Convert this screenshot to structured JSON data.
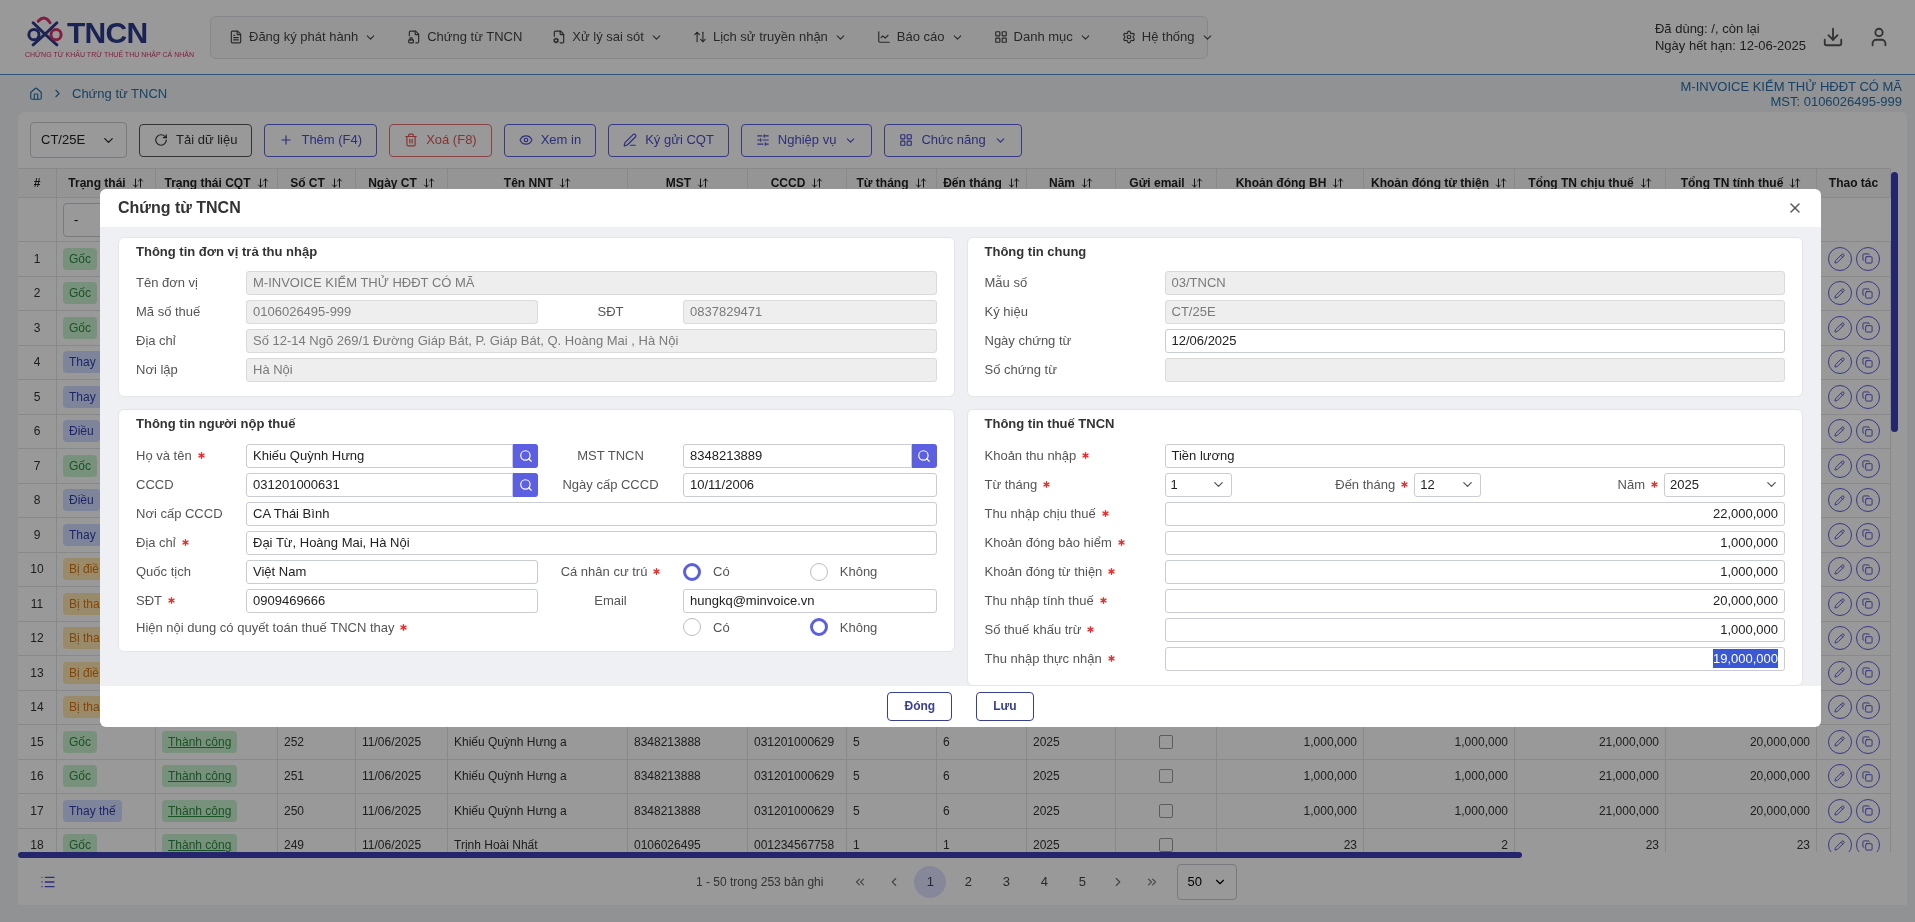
{
  "header": {
    "logo": "TNCN",
    "logo_tagline": "CHỨNG TỪ KHẤU TRỪ THUẾ THU NHẬP CÁ NHÂN",
    "nav": [
      {
        "label": "Đăng ký phát hành",
        "menu": true
      },
      {
        "label": "Chứng từ TNCN",
        "menu": false
      },
      {
        "label": "Xử lý sai sót",
        "menu": true
      },
      {
        "label": "Lịch sử truyền nhận",
        "menu": true
      },
      {
        "label": "Báo cáo",
        "menu": true
      },
      {
        "label": "Danh mục",
        "menu": true
      },
      {
        "label": "Hệ thống",
        "menu": true
      }
    ],
    "usage": "Đã dùng: /, còn lại",
    "expiry": "Ngày hết hạn: 12-06-2025"
  },
  "breadcrumb": [
    "Chứng từ TNCN"
  ],
  "company": {
    "name": "M-INVOICE KIỂM THỬ HĐĐT CÓ MÃ",
    "tax_code": "MST: 0106026495-999"
  },
  "toolbar": {
    "series": "CT/25E",
    "buttons": [
      {
        "label": "Tải dữ liệu",
        "kind": "plain",
        "menu": false
      },
      {
        "label": "Thêm (F4)",
        "kind": "primary",
        "menu": false
      },
      {
        "label": "Xoá (F8)",
        "kind": "danger",
        "menu": false
      },
      {
        "label": "Xem in",
        "kind": "primary",
        "menu": false
      },
      {
        "label": "Ký gửi CQT",
        "kind": "primary",
        "menu": false
      },
      {
        "label": "Nghiệp vụ",
        "kind": "primary",
        "menu": true
      },
      {
        "label": "Chức năng",
        "kind": "primary",
        "menu": true
      }
    ]
  },
  "table": {
    "columns": [
      {
        "label": "#",
        "sortable": false
      },
      {
        "label": "Trạng thái",
        "sortable": true
      },
      {
        "label": "Trạng thái CQT",
        "sortable": true
      },
      {
        "label": "Số CT",
        "sortable": true
      },
      {
        "label": "Ngày CT",
        "sortable": true
      },
      {
        "label": "Tên NNT",
        "sortable": true
      },
      {
        "label": "MST",
        "sortable": true
      },
      {
        "label": "CCCD",
        "sortable": true
      },
      {
        "label": "Từ tháng",
        "sortable": true
      },
      {
        "label": "Đến tháng",
        "sortable": true
      },
      {
        "label": "Năm",
        "sortable": true
      },
      {
        "label": "Gửi email",
        "sortable": true
      },
      {
        "label": "Khoản đóng BH",
        "sortable": true
      },
      {
        "label": "Khoản đóng từ thiện",
        "sortable": true
      },
      {
        "label": "Tổng TN chịu thuế",
        "sortable": true
      },
      {
        "label": "Tổng TN tính thuế",
        "sortable": true
      },
      {
        "label": "Thao tác",
        "sortable": false
      }
    ],
    "filter": "-",
    "rows": [
      {
        "number": "1",
        "status": {
          "label": "Gốc",
          "kind": "original"
        }
      },
      {
        "number": "2",
        "status": {
          "label": "Gốc",
          "kind": "original"
        }
      },
      {
        "number": "3",
        "status": {
          "label": "Gốc",
          "kind": "original"
        }
      },
      {
        "number": "4",
        "status": {
          "label": "Thay",
          "kind": "replacement"
        }
      },
      {
        "number": "5",
        "status": {
          "label": "Thay",
          "kind": "replacement"
        }
      },
      {
        "number": "6",
        "status": {
          "label": "Điều",
          "kind": "adjustment"
        }
      },
      {
        "number": "7",
        "status": {
          "label": "Gốc",
          "kind": "original"
        }
      },
      {
        "number": "8",
        "status": {
          "label": "Điều",
          "kind": "adjustment"
        }
      },
      {
        "number": "9",
        "status": {
          "label": "Thay",
          "kind": "replacement"
        }
      },
      {
        "number": "10",
        "status": {
          "label": "Bị điề",
          "kind": "adjusted"
        }
      },
      {
        "number": "11",
        "status": {
          "label": "Bị tha",
          "kind": "replaced"
        }
      },
      {
        "number": "12",
        "status": {
          "label": "Bị tha",
          "kind": "replaced"
        }
      },
      {
        "number": "13",
        "status": {
          "label": "Bị điề",
          "kind": "adjusted"
        }
      },
      {
        "number": "14",
        "status": {
          "label": "Bị tha",
          "kind": "replaced"
        }
      },
      {
        "number": "15",
        "status": {
          "label": "Gốc",
          "kind": "original"
        },
        "cqt_status": "Thành công",
        "so_ct": "252",
        "date": "11/06/2025",
        "name": "Khiếu Quỳnh Hưng a",
        "mst": "8348213888",
        "cccd": "031201000629",
        "from_month": "5",
        "to_month": "6",
        "year": "2025",
        "email_sent": false,
        "insurance": "1,000,000",
        "charity": "1,000,000",
        "taxable_total": "21,000,000",
        "assessable_total": "20,000,000"
      },
      {
        "number": "16",
        "status": {
          "label": "Gốc",
          "kind": "original"
        },
        "cqt_status": "Thành công",
        "so_ct": "251",
        "date": "11/06/2025",
        "name": "Khiếu Quỳnh Hưng a",
        "mst": "8348213888",
        "cccd": "031201000629",
        "from_month": "5",
        "to_month": "6",
        "year": "2025",
        "email_sent": false,
        "insurance": "1,000,000",
        "charity": "1,000,000",
        "taxable_total": "21,000,000",
        "assessable_total": "20,000,000"
      },
      {
        "number": "17",
        "status": {
          "label": "Thay thế",
          "kind": "replacement"
        },
        "cqt_status": "Thành công",
        "so_ct": "250",
        "date": "11/06/2025",
        "name": "Khiếu Quỳnh Hưng a",
        "mst": "8348213888",
        "cccd": "031201000629",
        "from_month": "5",
        "to_month": "6",
        "year": "2025",
        "email_sent": false,
        "insurance": "1,000,000",
        "charity": "1,000,000",
        "taxable_total": "21,000,000",
        "assessable_total": "20,000,000"
      },
      {
        "number": "18",
        "status": {
          "label": "Gốc",
          "kind": "original"
        },
        "cqt_status": "Thành công",
        "so_ct": "249",
        "date": "11/06/2025",
        "name": "Trịnh Hoài Nhất",
        "mst": "0106026495",
        "cccd": "001234567758",
        "from_month": "1",
        "to_month": "1",
        "year": "2025",
        "email_sent": false,
        "insurance": "23",
        "charity": "2",
        "taxable_total": "23",
        "assessable_total": "23"
      }
    ]
  },
  "pagination": {
    "summary": "1 - 50 trong 253 bản ghi",
    "pages": [
      {
        "label": "1",
        "selected": true
      },
      {
        "label": "2",
        "selected": false
      },
      {
        "label": "3",
        "selected": false
      },
      {
        "label": "4",
        "selected": false
      },
      {
        "label": "5",
        "selected": false
      }
    ],
    "page_size": "50"
  },
  "dialog": {
    "title": "Chứng từ TNCN",
    "left": [
      {
        "title": "Thông tin đơn vị trả thu nhập",
        "rows": [
          [
            {
              "kind": "text",
              "label": "Tên đơn vị",
              "value": "M-INVOICE KIỂM THỬ HĐĐT CÓ MÃ",
              "disabled": true,
              "required": false
            }
          ],
          [
            {
              "kind": "text",
              "label": "Mã số thuế",
              "value": "0106026495-999",
              "disabled": true,
              "required": false
            },
            {
              "kind": "text",
              "label": "SĐT",
              "value": "0837829471",
              "disabled": true,
              "required": false
            }
          ],
          [
            {
              "kind": "text",
              "label": "Địa chỉ",
              "value": "Số 12-14 Ngõ 269/1 Đường Giáp Bát, P. Giáp Bát, Q. Hoàng Mai , Hà Nội",
              "disabled": true,
              "required": false
            }
          ],
          [
            {
              "kind": "text",
              "label": "Nơi lập",
              "value": "Hà Nội",
              "disabled": true,
              "required": false
            }
          ]
        ]
      },
      {
        "title": "Thông tin người nộp thuế",
        "rows": [
          [
            {
              "kind": "text",
              "label": "Họ và tên",
              "value": "Khiếu Quỳnh Hưng",
              "disabled": false,
              "required": true,
              "search": true
            },
            {
              "kind": "text",
              "label": "MST TNCN",
              "value": "8348213889",
              "disabled": false,
              "required": false,
              "search": true
            }
          ],
          [
            {
              "kind": "text",
              "label": "CCCD",
              "value": "031201000631",
              "disabled": false,
              "required": false,
              "search": true
            },
            {
              "kind": "text",
              "label": "Ngày cấp CCCD",
              "value": "10/11/2006",
              "disabled": false,
              "required": false
            }
          ],
          [
            {
              "kind": "text",
              "label": "Nơi cấp CCCD",
              "value": "CA Thái Bình",
              "disabled": false,
              "required": false
            }
          ],
          [
            {
              "kind": "text",
              "label": "Địa chỉ",
              "value": "Đại Từ, Hoàng Mai, Hà Nội",
              "disabled": false,
              "required": true
            }
          ],
          [
            {
              "kind": "text",
              "label": "Quốc tịch",
              "value": "Việt Nam",
              "disabled": false,
              "required": false
            },
            {
              "kind": "radio",
              "label": "Cá nhân cư trú",
              "required": true,
              "options": [
                {
                  "label": "Có",
                  "selected": true
                },
                {
                  "label": "Không",
                  "selected": false
                }
              ]
            }
          ],
          [
            {
              "kind": "text",
              "label": "SĐT",
              "value": "0909469666",
              "disabled": false,
              "required": true
            },
            {
              "kind": "text",
              "label": "Email",
              "value": "hungkq@minvoice.vn",
              "disabled": false,
              "required": false
            }
          ],
          [
            {
              "kind": "radio",
              "label": "Hiện nội dung có quyết toán thuế TNCN thay",
              "required": true,
              "options": [
                {
                  "label": "Có",
                  "selected": false
                },
                {
                  "label": "Không",
                  "selected": true
                }
              ]
            }
          ]
        ]
      }
    ],
    "right": [
      {
        "title": "Thông tin chung",
        "rows": [
          [
            {
              "kind": "text",
              "label": "Mẫu số",
              "value": "03/TNCN",
              "disabled": true,
              "required": false
            }
          ],
          [
            {
              "kind": "text",
              "label": "Ký hiệu",
              "value": "CT/25E",
              "disabled": true,
              "required": false
            }
          ],
          [
            {
              "kind": "text",
              "label": "Ngày chứng từ",
              "value": "12/06/2025",
              "disabled": false,
              "required": false
            }
          ],
          [
            {
              "kind": "text",
              "label": "Số chứng từ",
              "disabled": true,
              "required": false
            }
          ]
        ]
      },
      {
        "title": "Thông tin thuế TNCN",
        "rows": [
          [
            {
              "kind": "text",
              "label": "Khoản thu nhập",
              "value": "Tiền lương",
              "disabled": false,
              "required": true
            }
          ],
          [
            {
              "kind": "select",
              "label": "Từ tháng",
              "value": "1",
              "required": true
            },
            {
              "kind": "select",
              "label": "Đến tháng",
              "value": "12",
              "required": true
            },
            {
              "kind": "select",
              "label": "Năm",
              "value": "2025",
              "required": true
            }
          ],
          [
            {
              "kind": "amount",
              "label": "Thu nhập chịu thuế",
              "value": "22,000,000",
              "required": true,
              "highlighted": false
            }
          ],
          [
            {
              "kind": "amount",
              "label": "Khoản đóng bảo hiểm",
              "value": "1,000,000",
              "required": true,
              "highlighted": false
            }
          ],
          [
            {
              "kind": "amount",
              "label": "Khoản đóng từ thiện",
              "value": "1,000,000",
              "required": true,
              "highlighted": false
            }
          ],
          [
            {
              "kind": "amount",
              "label": "Thu nhập tính thuế",
              "value": "20,000,000",
              "required": true,
              "highlighted": false
            }
          ],
          [
            {
              "kind": "amount",
              "label": "Số thuế khấu trừ",
              "value": "1,000,000",
              "required": true,
              "highlighted": false
            }
          ],
          [
            {
              "kind": "amount",
              "label": "Thu nhập thực nhận",
              "value": "19,000,000",
              "required": true,
              "highlighted": true
            }
          ]
        ]
      }
    ],
    "buttons": [
      "Đóng",
      "Lưu"
    ]
  }
}
